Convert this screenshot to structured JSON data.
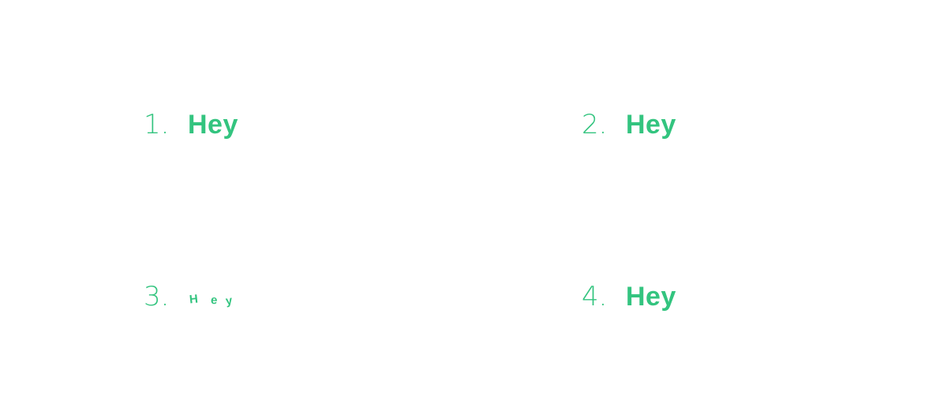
{
  "colors": {
    "accent": "#33c47f",
    "background": "#ffffff"
  },
  "items": [
    {
      "number": "1.",
      "text": "Hey"
    },
    {
      "number": "2.",
      "text": "Hey"
    },
    {
      "number": "3.",
      "text": "Hey",
      "letters": [
        "H",
        "e",
        "y"
      ]
    },
    {
      "number": "4.",
      "text": "Hey"
    }
  ]
}
